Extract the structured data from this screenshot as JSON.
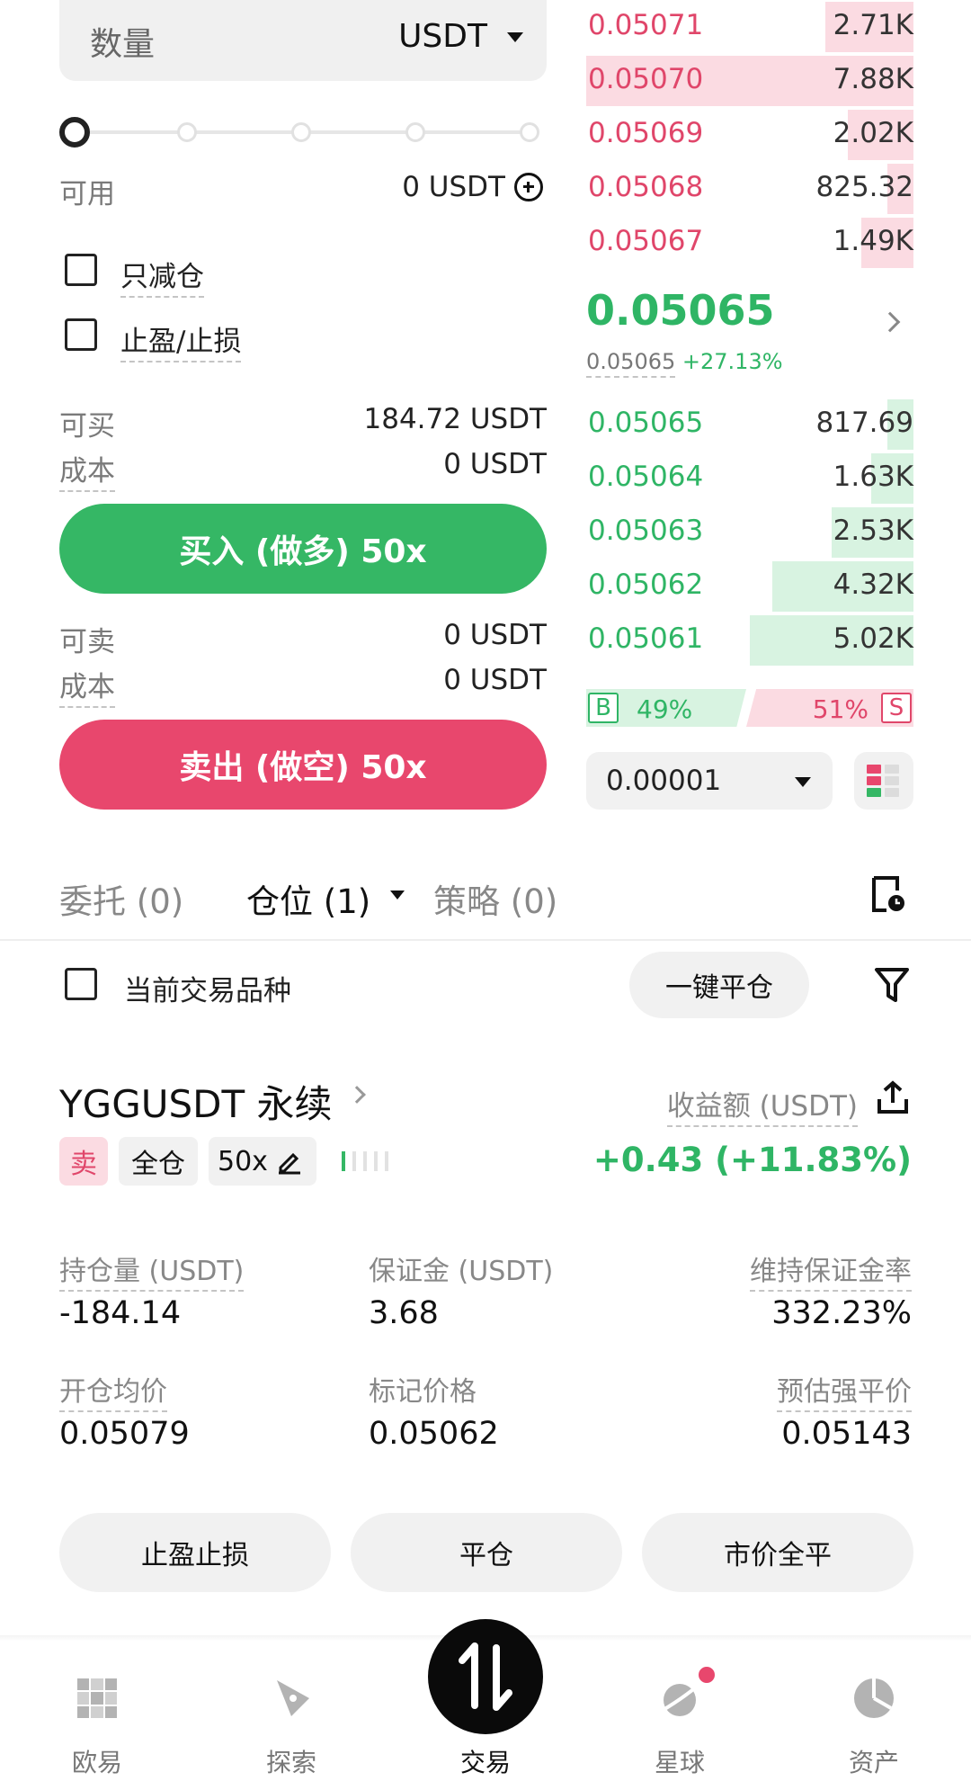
{
  "order_form": {
    "quantity_label": "数量",
    "quantity_unit": "USDT",
    "available_label": "可用",
    "available_value": "0 USDT",
    "reduce_only_label": "只减仓",
    "tpsl_label": "止盈/止损",
    "can_buy_label": "可买",
    "can_buy_value": "184.72 USDT",
    "buy_cost_label": "成本",
    "buy_cost_value": "0 USDT",
    "buy_button": "买入 (做多) 50x",
    "can_sell_label": "可卖",
    "can_sell_value": "0 USDT",
    "sell_cost_label": "成本",
    "sell_cost_value": "0 USDT",
    "sell_button": "卖出 (做空) 50x"
  },
  "order_book": {
    "asks": [
      {
        "price": "0.05071",
        "size": "2.71K",
        "depth": 0.27
      },
      {
        "price": "0.05070",
        "size": "7.88K",
        "depth": 1.0
      },
      {
        "price": "0.05069",
        "size": "2.02K",
        "depth": 0.2
      },
      {
        "price": "0.05068",
        "size": "825.32",
        "depth": 0.08
      },
      {
        "price": "0.05067",
        "size": "1.49K",
        "depth": 0.16
      }
    ],
    "last_price": "0.05065",
    "mark_price": "0.05065",
    "change": "+27.13%",
    "bids": [
      {
        "price": "0.05065",
        "size": "817.69",
        "depth": 0.08
      },
      {
        "price": "0.05064",
        "size": "1.63K",
        "depth": 0.13
      },
      {
        "price": "0.05063",
        "size": "2.53K",
        "depth": 0.25
      },
      {
        "price": "0.05062",
        "size": "4.32K",
        "depth": 0.43
      },
      {
        "price": "0.05061",
        "size": "5.02K",
        "depth": 0.5
      }
    ],
    "buy_ratio_tag": "B",
    "buy_ratio": "49%",
    "sell_ratio": "51%",
    "sell_ratio_tag": "S",
    "tick_size": "0.00001"
  },
  "tabs": {
    "orders": "委托 (0)",
    "positions": "仓位 (1)",
    "strategies": "策略 (0)"
  },
  "filter": {
    "current_symbol_label": "当前交易品种",
    "close_all": "一键平仓"
  },
  "position": {
    "symbol": "YGGUSDT 永续",
    "pnl_label": "收益额 (USDT)",
    "pnl_value": "+0.43 (+11.83%)",
    "side_tag": "卖",
    "margin_mode": "全仓",
    "leverage": "50x",
    "size_label": "持仓量 (USDT)",
    "size_value": "-184.14",
    "margin_label": "保证金 (USDT)",
    "margin_value": "3.68",
    "mmr_label": "维持保证金率",
    "mmr_value": "332.23%",
    "entry_label": "开仓均价",
    "entry_value": "0.05079",
    "mark_label": "标记价格",
    "mark_value": "0.05062",
    "liq_label": "预估强平价",
    "liq_value": "0.05143",
    "tpsl_button": "止盈止损",
    "close_button": "平仓",
    "market_close_button": "市价全平"
  },
  "bottom_nav": {
    "home": "欧易",
    "discover": "探索",
    "trade": "交易",
    "planet": "星球",
    "assets": "资产"
  },
  "colors": {
    "buy_green": "#35b765",
    "sell_red": "#e8476d"
  }
}
